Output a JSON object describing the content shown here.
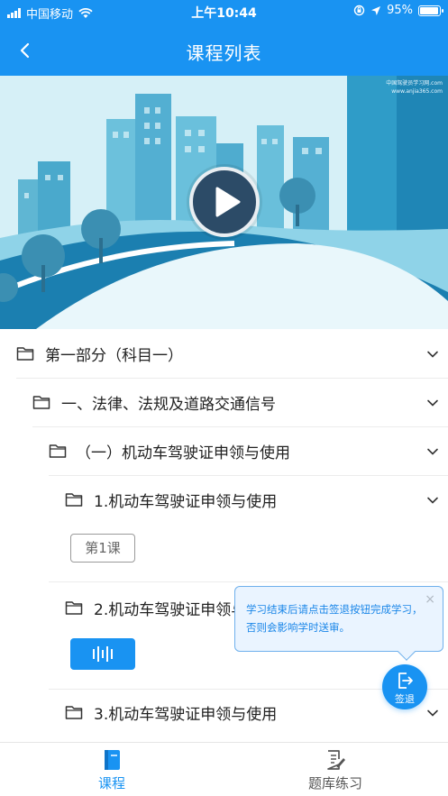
{
  "status_bar": {
    "carrier": "中国移动",
    "time": "上午10:44",
    "battery": "95%",
    "battery_level": 0.95
  },
  "navbar": {
    "title": "课程列表"
  },
  "video": {
    "watermark_line1": "中国驾驶员学习网.com",
    "watermark_line2": "www.anjia365.com"
  },
  "course_tree": [
    {
      "title": "第一部分（科目一）",
      "level": 1
    },
    {
      "title": "一、法律、法规及道路交通信号",
      "level": 2
    },
    {
      "title": "（一）机动车驾驶证申领与使用",
      "level": 3
    },
    {
      "title": "1.机动车驾驶证申领与使用",
      "level": 4
    },
    {
      "title": "2.机动车驾驶证申领与使用",
      "level": 4
    },
    {
      "title": "3.机动车驾驶证申领与使用",
      "level": 4
    }
  ],
  "lesson_button": "第1课",
  "tooltip": {
    "line1": "学习结束后请点击签退按钮完成学习，",
    "line2": "否则会影响学时送审。",
    "close": "×"
  },
  "signout_label": "签退",
  "tabbar": {
    "tabs": [
      {
        "label": "课程",
        "active": true
      },
      {
        "label": "题库练习",
        "active": false
      }
    ]
  },
  "colors": {
    "primary": "#1993f2",
    "tooltip_bg": "#eaf4ff",
    "tooltip_text": "#1a86e8",
    "inactive_tab": "#555555"
  }
}
